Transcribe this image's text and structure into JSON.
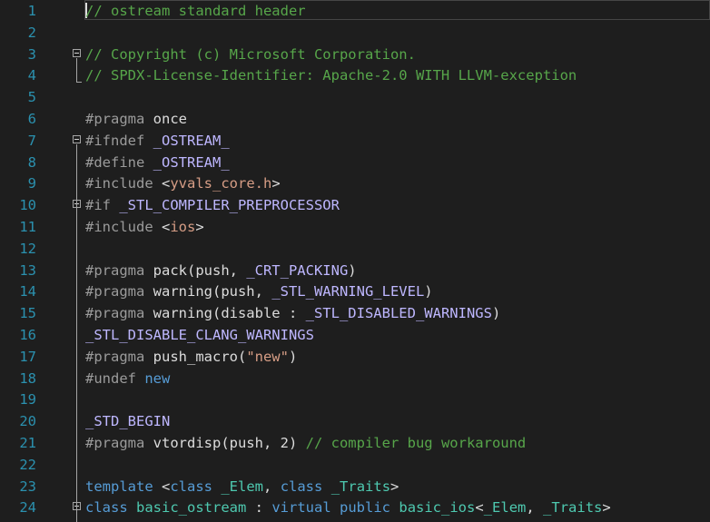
{
  "editor": {
    "theme": {
      "background": "#1e1e1e",
      "line_number": "#2b91af",
      "comment": "#57a64a",
      "preprocessor": "#9b9b9b",
      "keyword": "#569cd6",
      "string": "#d69d85",
      "macro": "#beb7ff",
      "default": "#dcdcdc",
      "type": "#4ec9b0"
    },
    "lines": [
      {
        "n": "1",
        "tokens": [
          {
            "t": "// ostream standard header",
            "c": "comment"
          }
        ]
      },
      {
        "n": "2",
        "tokens": []
      },
      {
        "n": "3",
        "tokens": [
          {
            "t": "// Copyright (c) Microsoft Corporation.",
            "c": "comment"
          }
        ]
      },
      {
        "n": "4",
        "tokens": [
          {
            "t": "// SPDX-License-Identifier: Apache-2.0 WITH LLVM-exception",
            "c": "comment"
          }
        ]
      },
      {
        "n": "5",
        "tokens": []
      },
      {
        "n": "6",
        "tokens": [
          {
            "t": "#pragma",
            "c": "preprocessor"
          },
          {
            "t": " once",
            "c": "default"
          }
        ]
      },
      {
        "n": "7",
        "tokens": [
          {
            "t": "#ifndef",
            "c": "preprocessor"
          },
          {
            "t": " _OSTREAM_",
            "c": "macro"
          }
        ]
      },
      {
        "n": "8",
        "tokens": [
          {
            "t": "#define",
            "c": "preprocessor"
          },
          {
            "t": " _OSTREAM_",
            "c": "macro"
          }
        ]
      },
      {
        "n": "9",
        "tokens": [
          {
            "t": "#include",
            "c": "preprocessor"
          },
          {
            "t": " <",
            "c": "default"
          },
          {
            "t": "yvals_core.h",
            "c": "string"
          },
          {
            "t": ">",
            "c": "default"
          }
        ]
      },
      {
        "n": "10",
        "tokens": [
          {
            "t": "#if",
            "c": "preprocessor"
          },
          {
            "t": " _STL_COMPILER_PREPROCESSOR",
            "c": "macro"
          }
        ]
      },
      {
        "n": "11",
        "tokens": [
          {
            "t": "#include",
            "c": "preprocessor"
          },
          {
            "t": " <",
            "c": "default"
          },
          {
            "t": "ios",
            "c": "string"
          },
          {
            "t": ">",
            "c": "default"
          }
        ]
      },
      {
        "n": "12",
        "tokens": []
      },
      {
        "n": "13",
        "tokens": [
          {
            "t": "#pragma",
            "c": "preprocessor"
          },
          {
            "t": " pack(push, ",
            "c": "default"
          },
          {
            "t": "_CRT_PACKING",
            "c": "macro"
          },
          {
            "t": ")",
            "c": "default"
          }
        ]
      },
      {
        "n": "14",
        "tokens": [
          {
            "t": "#pragma",
            "c": "preprocessor"
          },
          {
            "t": " warning(push, ",
            "c": "default"
          },
          {
            "t": "_STL_WARNING_LEVEL",
            "c": "macro"
          },
          {
            "t": ")",
            "c": "default"
          }
        ]
      },
      {
        "n": "15",
        "tokens": [
          {
            "t": "#pragma",
            "c": "preprocessor"
          },
          {
            "t": " warning(disable : ",
            "c": "default"
          },
          {
            "t": "_STL_DISABLED_WARNINGS",
            "c": "macro"
          },
          {
            "t": ")",
            "c": "default"
          }
        ]
      },
      {
        "n": "16",
        "tokens": [
          {
            "t": "_STL_DISABLE_CLANG_WARNINGS",
            "c": "macro"
          }
        ]
      },
      {
        "n": "17",
        "tokens": [
          {
            "t": "#pragma",
            "c": "preprocessor"
          },
          {
            "t": " push_macro(",
            "c": "default"
          },
          {
            "t": "\"new\"",
            "c": "string"
          },
          {
            "t": ")",
            "c": "default"
          }
        ]
      },
      {
        "n": "18",
        "tokens": [
          {
            "t": "#undef",
            "c": "preprocessor"
          },
          {
            "t": " ",
            "c": "default"
          },
          {
            "t": "new",
            "c": "keyword"
          }
        ]
      },
      {
        "n": "19",
        "tokens": []
      },
      {
        "n": "20",
        "tokens": [
          {
            "t": "_STD_BEGIN",
            "c": "macro"
          }
        ]
      },
      {
        "n": "21",
        "tokens": [
          {
            "t": "#pragma",
            "c": "preprocessor"
          },
          {
            "t": " vtordisp(push, 2) ",
            "c": "default"
          },
          {
            "t": "// compiler bug workaround",
            "c": "comment"
          }
        ]
      },
      {
        "n": "22",
        "tokens": []
      },
      {
        "n": "23",
        "tokens": [
          {
            "t": "template",
            "c": "keyword"
          },
          {
            "t": " <",
            "c": "default"
          },
          {
            "t": "class",
            "c": "keyword"
          },
          {
            "t": " ",
            "c": "default"
          },
          {
            "t": "_Elem",
            "c": "type"
          },
          {
            "t": ", ",
            "c": "default"
          },
          {
            "t": "class",
            "c": "keyword"
          },
          {
            "t": " ",
            "c": "default"
          },
          {
            "t": "_Traits",
            "c": "type"
          },
          {
            "t": ">",
            "c": "default"
          }
        ]
      },
      {
        "n": "24",
        "tokens": [
          {
            "t": "class",
            "c": "keyword"
          },
          {
            "t": " ",
            "c": "default"
          },
          {
            "t": "basic_ostream",
            "c": "type"
          },
          {
            "t": " : ",
            "c": "default"
          },
          {
            "t": "virtual",
            "c": "keyword"
          },
          {
            "t": " ",
            "c": "default"
          },
          {
            "t": "public",
            "c": "keyword"
          },
          {
            "t": " ",
            "c": "default"
          },
          {
            "t": "basic_ios",
            "c": "type"
          },
          {
            "t": "<",
            "c": "default"
          },
          {
            "t": "_Elem",
            "c": "type"
          },
          {
            "t": ", ",
            "c": "default"
          },
          {
            "t": "_Traits",
            "c": "type"
          },
          {
            "t": ">",
            "c": "default"
          }
        ]
      }
    ],
    "folds": [
      "3",
      "7",
      "10",
      "24"
    ]
  }
}
